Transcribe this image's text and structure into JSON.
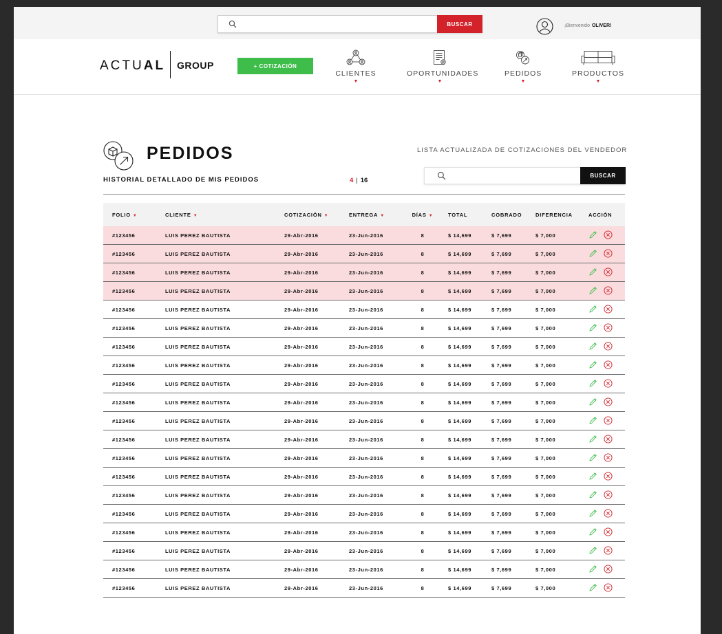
{
  "topbar": {
    "search": {
      "placeholder": "",
      "button_label": "BUSCAR"
    },
    "welcome": {
      "greeting": "¡Bienvenido",
      "user": "OLIVER!"
    }
  },
  "navbar": {
    "logo": {
      "part1": "ACTU",
      "part2": "AL",
      "group": "GROUP"
    },
    "new_quote_label": "+ COTIZACIÓN",
    "items": [
      {
        "label": "CLIENTES",
        "icon": "clients-icon"
      },
      {
        "label": "OPORTUNIDADES",
        "icon": "document-icon"
      },
      {
        "label": "PEDIDOS",
        "icon": "orders-icon"
      },
      {
        "label": "PRODUCTOS",
        "icon": "sofa-icon"
      }
    ]
  },
  "section": {
    "title": "PEDIDOS",
    "subtitle": "HISTORIAL DETALLADO DE MIS PEDIDOS",
    "page_current": "4",
    "page_separator": "|",
    "page_total": "16",
    "list_caption": "LISTA ACTUALIZADA DE COTIZACIONES DEL VENDEDOR",
    "search_placeholder": "",
    "search_button": "BUSCAR"
  },
  "colors": {
    "accent_red": "#d3222a",
    "accent_green": "#3ebd4b",
    "highlight_row": "#fadcde"
  },
  "table": {
    "columns": [
      {
        "label": "FOLIO",
        "sortable": true
      },
      {
        "label": "CLIENTE",
        "sortable": true
      },
      {
        "label": "COTIZACIÓN",
        "sortable": true
      },
      {
        "label": "ENTREGA",
        "sortable": true
      },
      {
        "label": "DÍAS",
        "sortable": true
      },
      {
        "label": "TOTAL",
        "sortable": false
      },
      {
        "label": "COBRADO",
        "sortable": false
      },
      {
        "label": "DIFERENCIA",
        "sortable": false
      },
      {
        "label": "ACCIÓN",
        "sortable": false
      }
    ],
    "rows": [
      {
        "folio": "#123456",
        "cliente": "LUIS PEREZ BAUTISTA",
        "cotizacion": "29-Abr-2016",
        "entrega": "23-Jun-2016",
        "dias": "8",
        "total": "$ 14,699",
        "cobrado": "$ 7,699",
        "diferencia": "$ 7,000",
        "highlight": true
      },
      {
        "folio": "#123456",
        "cliente": "LUIS PEREZ BAUTISTA",
        "cotizacion": "29-Abr-2016",
        "entrega": "23-Jun-2016",
        "dias": "8",
        "total": "$ 14,699",
        "cobrado": "$ 7,699",
        "diferencia": "$ 7,000",
        "highlight": true
      },
      {
        "folio": "#123456",
        "cliente": "LUIS PEREZ BAUTISTA",
        "cotizacion": "29-Abr-2016",
        "entrega": "23-Jun-2016",
        "dias": "8",
        "total": "$ 14,699",
        "cobrado": "$ 7,699",
        "diferencia": "$ 7,000",
        "highlight": true
      },
      {
        "folio": "#123456",
        "cliente": "LUIS PEREZ BAUTISTA",
        "cotizacion": "29-Abr-2016",
        "entrega": "23-Jun-2016",
        "dias": "8",
        "total": "$ 14,699",
        "cobrado": "$ 7,699",
        "diferencia": "$ 7,000",
        "highlight": true
      },
      {
        "folio": "#123456",
        "cliente": "LUIS PEREZ BAUTISTA",
        "cotizacion": "29-Abr-2016",
        "entrega": "23-Jun-2016",
        "dias": "8",
        "total": "$ 14,699",
        "cobrado": "$ 7,699",
        "diferencia": "$ 7,000",
        "highlight": false
      },
      {
        "folio": "#123456",
        "cliente": "LUIS PEREZ BAUTISTA",
        "cotizacion": "29-Abr-2016",
        "entrega": "23-Jun-2016",
        "dias": "8",
        "total": "$ 14,699",
        "cobrado": "$ 7,699",
        "diferencia": "$ 7,000",
        "highlight": false
      },
      {
        "folio": "#123456",
        "cliente": "LUIS PEREZ BAUTISTA",
        "cotizacion": "29-Abr-2016",
        "entrega": "23-Jun-2016",
        "dias": "8",
        "total": "$ 14,699",
        "cobrado": "$ 7,699",
        "diferencia": "$ 7,000",
        "highlight": false
      },
      {
        "folio": "#123456",
        "cliente": "LUIS PEREZ BAUTISTA",
        "cotizacion": "29-Abr-2016",
        "entrega": "23-Jun-2016",
        "dias": "8",
        "total": "$ 14,699",
        "cobrado": "$ 7,699",
        "diferencia": "$ 7,000",
        "highlight": false
      },
      {
        "folio": "#123456",
        "cliente": "LUIS PEREZ BAUTISTA",
        "cotizacion": "29-Abr-2016",
        "entrega": "23-Jun-2016",
        "dias": "8",
        "total": "$ 14,699",
        "cobrado": "$ 7,699",
        "diferencia": "$ 7,000",
        "highlight": false
      },
      {
        "folio": "#123456",
        "cliente": "LUIS PEREZ BAUTISTA",
        "cotizacion": "29-Abr-2016",
        "entrega": "23-Jun-2016",
        "dias": "8",
        "total": "$ 14,699",
        "cobrado": "$ 7,699",
        "diferencia": "$ 7,000",
        "highlight": false
      },
      {
        "folio": "#123456",
        "cliente": "LUIS PEREZ BAUTISTA",
        "cotizacion": "29-Abr-2016",
        "entrega": "23-Jun-2016",
        "dias": "8",
        "total": "$ 14,699",
        "cobrado": "$ 7,699",
        "diferencia": "$ 7,000",
        "highlight": false
      },
      {
        "folio": "#123456",
        "cliente": "LUIS PEREZ BAUTISTA",
        "cotizacion": "29-Abr-2016",
        "entrega": "23-Jun-2016",
        "dias": "8",
        "total": "$ 14,699",
        "cobrado": "$ 7,699",
        "diferencia": "$ 7,000",
        "highlight": false
      },
      {
        "folio": "#123456",
        "cliente": "LUIS PEREZ BAUTISTA",
        "cotizacion": "29-Abr-2016",
        "entrega": "23-Jun-2016",
        "dias": "8",
        "total": "$ 14,699",
        "cobrado": "$ 7,699",
        "diferencia": "$ 7,000",
        "highlight": false
      },
      {
        "folio": "#123456",
        "cliente": "LUIS PEREZ BAUTISTA",
        "cotizacion": "29-Abr-2016",
        "entrega": "23-Jun-2016",
        "dias": "8",
        "total": "$ 14,699",
        "cobrado": "$ 7,699",
        "diferencia": "$ 7,000",
        "highlight": false
      },
      {
        "folio": "#123456",
        "cliente": "LUIS PEREZ BAUTISTA",
        "cotizacion": "29-Abr-2016",
        "entrega": "23-Jun-2016",
        "dias": "8",
        "total": "$ 14,699",
        "cobrado": "$ 7,699",
        "diferencia": "$ 7,000",
        "highlight": false
      },
      {
        "folio": "#123456",
        "cliente": "LUIS PEREZ BAUTISTA",
        "cotizacion": "29-Abr-2016",
        "entrega": "23-Jun-2016",
        "dias": "8",
        "total": "$ 14,699",
        "cobrado": "$ 7,699",
        "diferencia": "$ 7,000",
        "highlight": false
      },
      {
        "folio": "#123456",
        "cliente": "LUIS PEREZ BAUTISTA",
        "cotizacion": "29-Abr-2016",
        "entrega": "23-Jun-2016",
        "dias": "8",
        "total": "$ 14,699",
        "cobrado": "$ 7,699",
        "diferencia": "$ 7,000",
        "highlight": false
      },
      {
        "folio": "#123456",
        "cliente": "LUIS PEREZ BAUTISTA",
        "cotizacion": "29-Abr-2016",
        "entrega": "23-Jun-2016",
        "dias": "8",
        "total": "$ 14,699",
        "cobrado": "$ 7,699",
        "diferencia": "$ 7,000",
        "highlight": false
      },
      {
        "folio": "#123456",
        "cliente": "LUIS PEREZ BAUTISTA",
        "cotizacion": "29-Abr-2016",
        "entrega": "23-Jun-2016",
        "dias": "8",
        "total": "$ 14,699",
        "cobrado": "$ 7,699",
        "diferencia": "$ 7,000",
        "highlight": false
      },
      {
        "folio": "#123456",
        "cliente": "LUIS PEREZ BAUTISTA",
        "cotizacion": "29-Abr-2016",
        "entrega": "23-Jun-2016",
        "dias": "8",
        "total": "$ 14,699",
        "cobrado": "$ 7,699",
        "diferencia": "$ 7,000",
        "highlight": false
      }
    ],
    "actions": {
      "edit": "edit-icon",
      "delete": "delete-icon"
    }
  }
}
